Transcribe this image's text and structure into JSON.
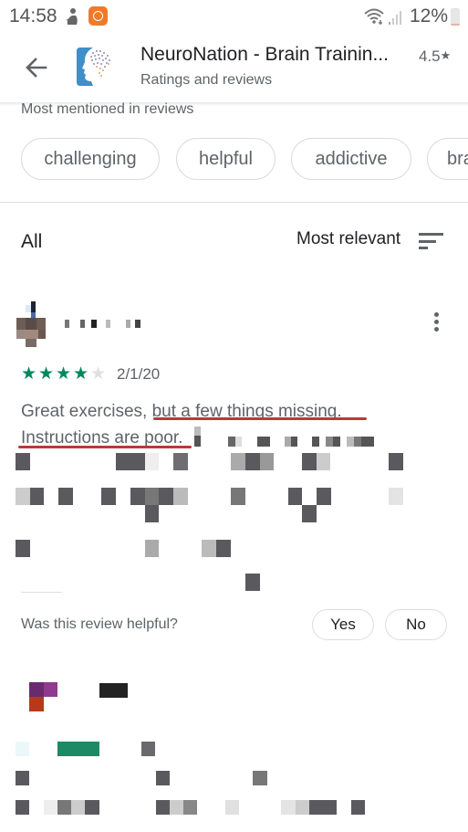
{
  "status_bar": {
    "time": "14:58",
    "battery_percent": "12%",
    "battery_level": 0.12,
    "icons": [
      "person-notification-icon",
      "app-notification-icon",
      "wifi-icon",
      "signal-icon",
      "battery-icon"
    ]
  },
  "header": {
    "back_icon": "arrow-left-icon",
    "app_name": "NeuroNation - Brain Trainin...",
    "rating": "4.5",
    "rating_star": "★",
    "subtitle": "Ratings and reviews"
  },
  "mentions": {
    "label": "Most mentioned in reviews",
    "chips": [
      "challenging",
      "helpful",
      "addictive",
      "bra"
    ]
  },
  "filter": {
    "all_label": "All",
    "sort_label": "Most relevant",
    "sort_icon": "sort-icon"
  },
  "review": {
    "author_name": "(pixelated)",
    "rating": 4,
    "max_rating": 5,
    "star_glyph": "★",
    "date": "2/1/20",
    "text_line_1": "Great exercises, but a few things missing.",
    "text_line_2": "Instructions are poor.",
    "more_icon": "more-vert-icon",
    "helpful_question": "Was this review helpful?",
    "yes_label": "Yes",
    "no_label": "No"
  },
  "colors": {
    "star_filled": "#01875f",
    "star_empty": "#e0e0e0",
    "underline": "#b83a3a",
    "text_secondary": "#5f6368",
    "text_primary": "#202124"
  }
}
